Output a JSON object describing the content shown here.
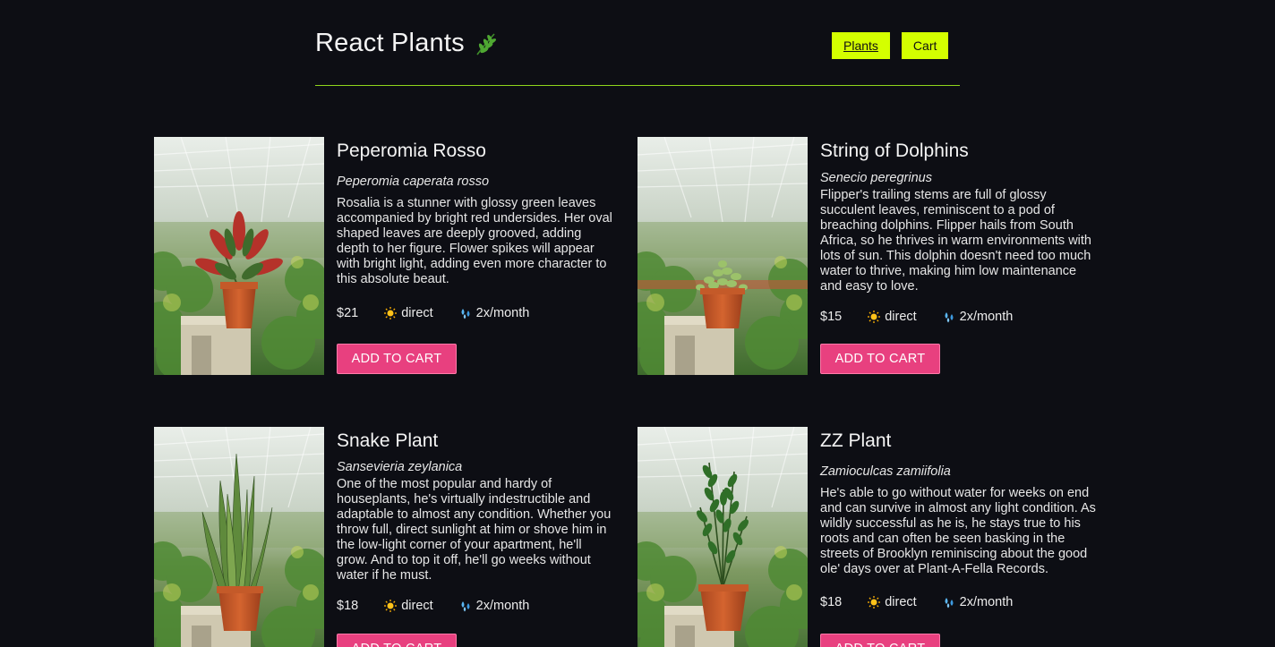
{
  "header": {
    "title": "React Plants",
    "logo_icon": "leaf-icon",
    "nav": [
      {
        "label": "Plants",
        "active": true
      },
      {
        "label": "Cart",
        "active": false
      }
    ]
  },
  "colors": {
    "background": "#0d0e14",
    "nav_accent": "#d4ff00",
    "divider": "#8fd61c",
    "add_button": "#e8407f"
  },
  "plants": [
    {
      "name": "Peperomia Rosso",
      "botanical": "Peperomia caperata rosso",
      "description": "Rosalia is a stunner with glossy green leaves accompanied by bright red undersides. Her oval shaped leaves are deeply grooved, adding depth to her figure. Flower spikes will appear with bright light, adding even more character to this absolute beaut.",
      "price": "$21",
      "light": "direct",
      "light_icon": "sun-icon",
      "water": "2x/month",
      "water_icon": "water-drops-icon",
      "button": "ADD TO CART"
    },
    {
      "name": "String of Dolphins",
      "botanical": "Senecio peregrinus",
      "description": "Flipper's trailing stems are full of glossy succulent leaves, reminiscent to a pod of breaching dolphins. Flipper hails from South Africa, so he thrives in warm environments with lots of sun. This dolphin doesn't need too much water to thrive, making him low maintenance and easy to love.",
      "price": "$15",
      "light": "direct",
      "light_icon": "sun-icon",
      "water": "2x/month",
      "water_icon": "water-drops-icon",
      "button": "ADD TO CART"
    },
    {
      "name": "Snake Plant",
      "botanical": "Sansevieria zeylanica",
      "description": "One of the most popular and hardy of houseplants, he's virtually indestructible and adaptable to almost any condition. Whether you throw full, direct sunlight at him or shove him in the low-light corner of your apartment, he'll grow. And to top it off, he'll go weeks without water if he must.",
      "price": "$18",
      "light": "direct",
      "light_icon": "sun-icon",
      "water": "2x/month",
      "water_icon": "water-drops-icon",
      "button": "ADD TO CART"
    },
    {
      "name": "ZZ Plant",
      "botanical": "Zamioculcas zamiifolia",
      "description": "He's able to go without water for weeks on end and can survive in almost any light condition. As wildly successful as he is, he stays true to his roots and can often be seen basking in the streets of Brooklyn reminiscing about the good ole' days over at Plant-A-Fella Records.",
      "price": "$18",
      "light": "direct",
      "light_icon": "sun-icon",
      "water": "2x/month",
      "water_icon": "water-drops-icon",
      "button": "ADD TO CART"
    }
  ]
}
